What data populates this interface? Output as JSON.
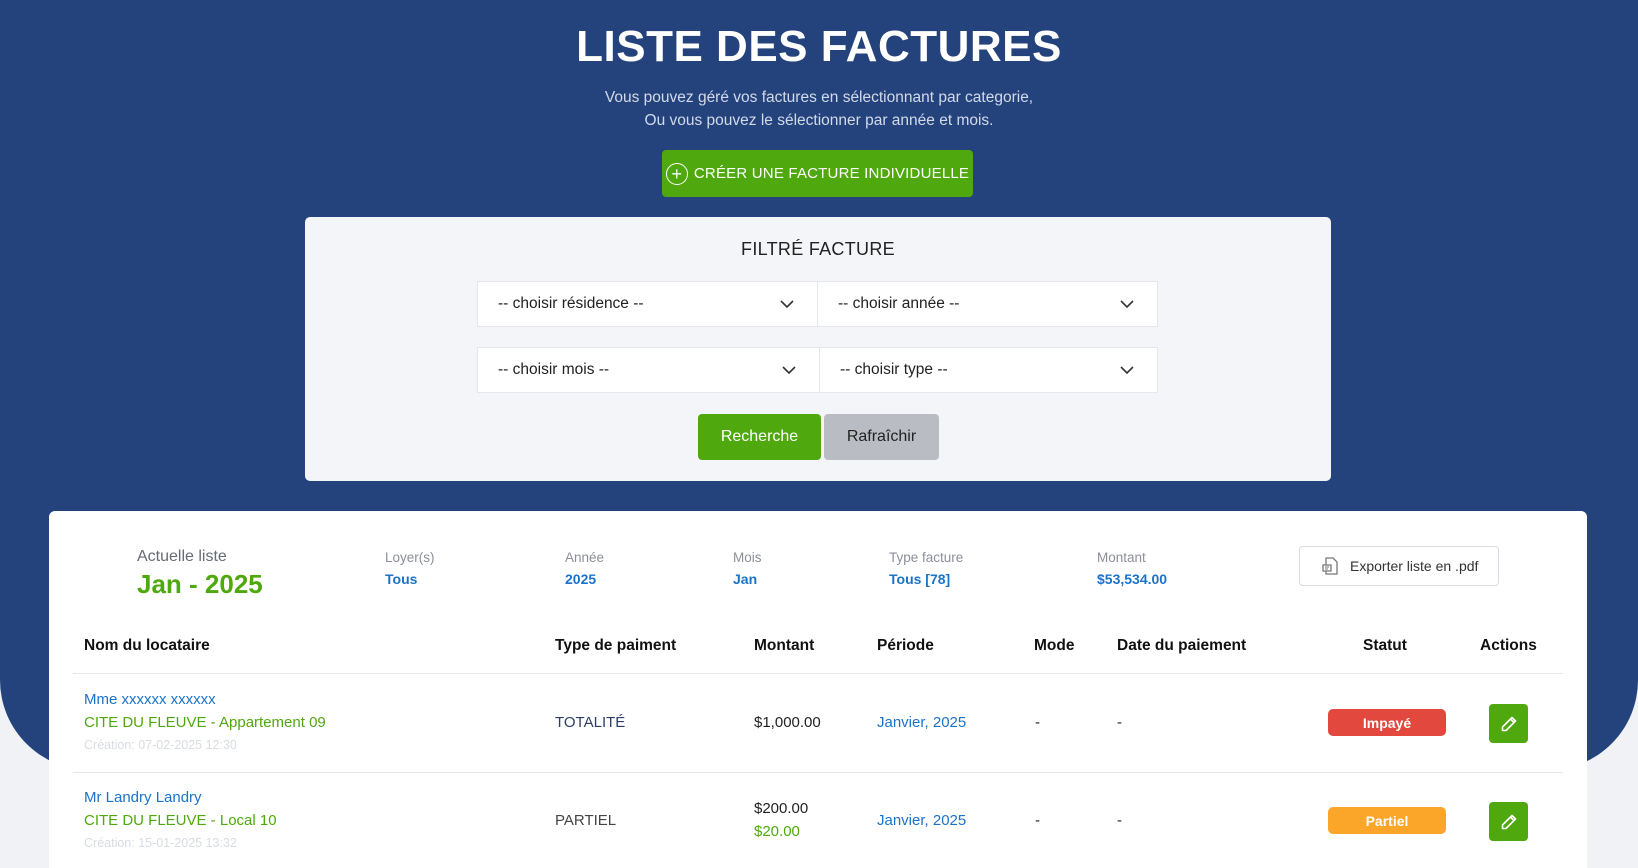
{
  "header": {
    "title": "LISTE DES FACTURES",
    "subtitle_line1": "Vous pouvez géré vos factures en sélectionnant par categorie,",
    "subtitle_line2": "Ou vous pouvez le sélectionner par année et mois.",
    "create_button_label": "CRÉER UNE FACTURE INDIVIDUELLE"
  },
  "filter": {
    "title": "FILTRÉ FACTURE",
    "residence_placeholder": "-- choisir résidence --",
    "year_placeholder": "-- choisir année --",
    "month_placeholder": "-- choisir mois --",
    "type_placeholder": "-- choisir type --",
    "search_label": "Recherche",
    "refresh_label": "Rafraîchir"
  },
  "summary": {
    "current_label": "Actuelle liste",
    "current_value": "Jan - 2025",
    "rent_label": "Loyer(s)",
    "rent_value": "Tous",
    "year_label": "Année",
    "year_value": "2025",
    "month_label": "Mois",
    "month_value": "Jan",
    "type_label": "Type facture",
    "type_value": "Tous [78]",
    "amount_label": "Montant",
    "amount_value": "$53,534.00",
    "export_label": "Exporter liste en .pdf"
  },
  "table": {
    "headers": {
      "tenant": "Nom du locataire",
      "payment_type": "Type de paiment",
      "amount": "Montant",
      "period": "Période",
      "mode": "Mode",
      "payment_date": "Date du paiement",
      "status": "Statut",
      "actions": "Actions"
    },
    "rows": [
      {
        "tenant": "Mme xxxxxx xxxxxx",
        "residence": "CITE DU FLEUVE - Appartement 09",
        "created": "Création: 07-02-2025 12:30",
        "payment_type": "TOTALITÉ",
        "amount": "$1,000.00",
        "amount_paid": "",
        "period": "Janvier, 2025",
        "mode": "-",
        "payment_date": "-",
        "status": "Impayé",
        "status_color": "#e2483d"
      },
      {
        "tenant": "Mr Landry Landry",
        "residence": "CITE DU FLEUVE - Local 10",
        "created": "Création: 15-01-2025 13:32",
        "payment_type": "PARTIEL",
        "amount": "$200.00",
        "amount_paid": "$20.00",
        "period": "Janvier, 2025",
        "mode": "-",
        "payment_date": "-",
        "status": "Partiel",
        "status_color": "#fba529"
      }
    ]
  },
  "colors": {
    "hero": "#24437d",
    "accent_green": "#4fa80d",
    "link_blue": "#1a73c9"
  },
  "icons": {
    "create": "plus-circle-icon",
    "select": "chevron-down-icon",
    "export": "pdf-file-icon",
    "edit": "pencil-icon"
  }
}
